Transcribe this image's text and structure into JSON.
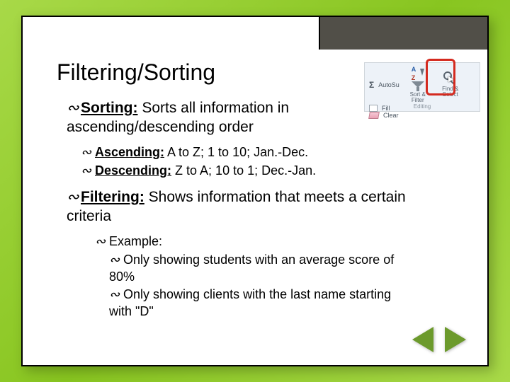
{
  "title": "Filtering/Sorting",
  "bullets": {
    "sorting": {
      "label": "Sorting:",
      "text": "  Sorts all information in ascending/descending order"
    },
    "ascending": {
      "label": "Ascending:",
      "text": " A to Z; 1 to 10; Jan.-Dec."
    },
    "descending": {
      "label": "Descending:",
      "text": " Z to A; 10 to 1; Dec.-Jan."
    },
    "filtering": {
      "label": "Filtering:",
      "text": "  Shows information that meets a certain criteria"
    },
    "example": {
      "label": "Example:"
    },
    "ex1": "Only showing students with an average score of 80%",
    "ex2": "Only showing clients with the last name starting with \"D\""
  },
  "ribbon": {
    "autosum": "AutoSu",
    "fill": "Fill",
    "clear": "Clear",
    "sort_filter": "Sort & Filter",
    "find_select": "Find & Select",
    "group": "Editing"
  },
  "glyph": "∾"
}
